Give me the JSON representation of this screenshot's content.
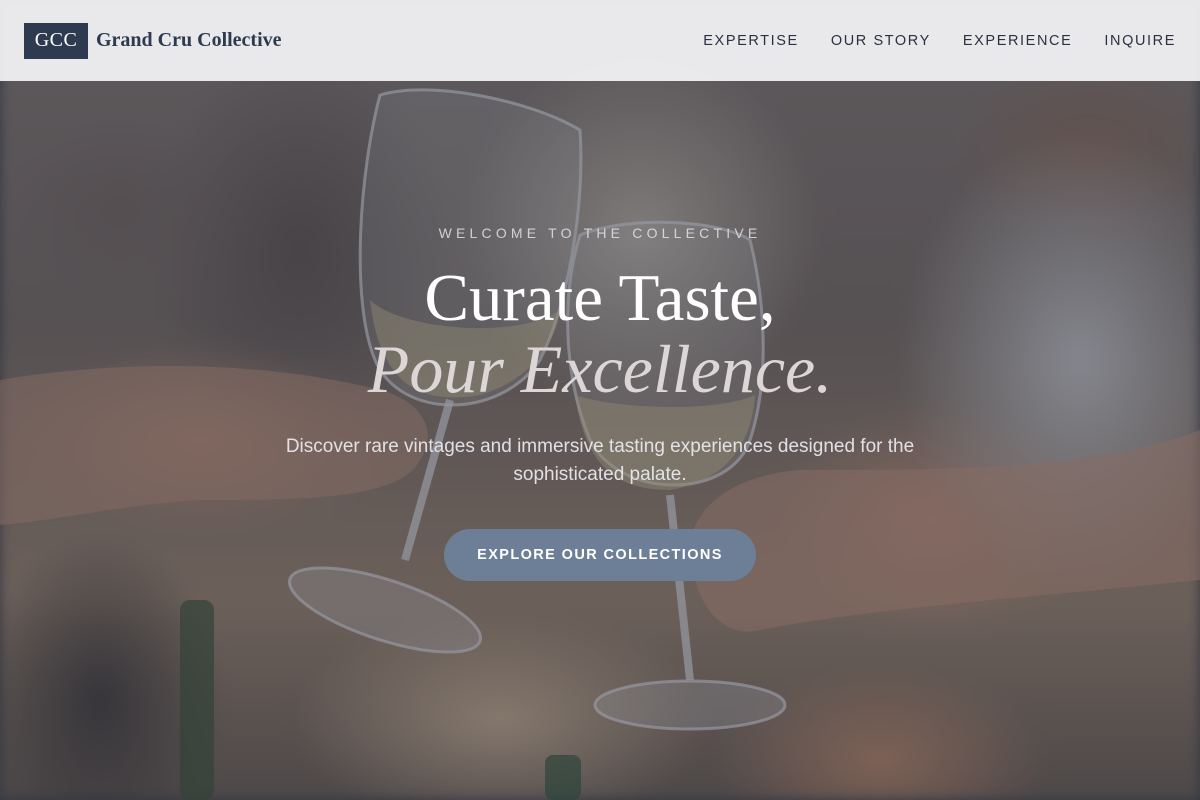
{
  "header": {
    "logo_mark": "GCC",
    "brand_name": "Grand Cru Collective",
    "nav": [
      "EXPERTISE",
      "OUR STORY",
      "EXPERIENCE",
      "INQUIRE"
    ]
  },
  "hero": {
    "eyebrow": "WELCOME TO THE COLLECTIVE",
    "headline_line1": "Curate Taste,",
    "headline_line2": "Pour Excellence.",
    "subtitle": "Discover rare vintages and immersive tasting experiences designed for the sophisticated palate.",
    "cta_label": "EXPLORE OUR COLLECTIONS",
    "background": "blurred photo of hands toasting with white wine glasses"
  },
  "colors": {
    "brand_navy": "#2e3a4f",
    "header_bg": "#f4f4f6",
    "cta_bg": "#6c7f96",
    "hero_overlay": "#282c3a"
  }
}
